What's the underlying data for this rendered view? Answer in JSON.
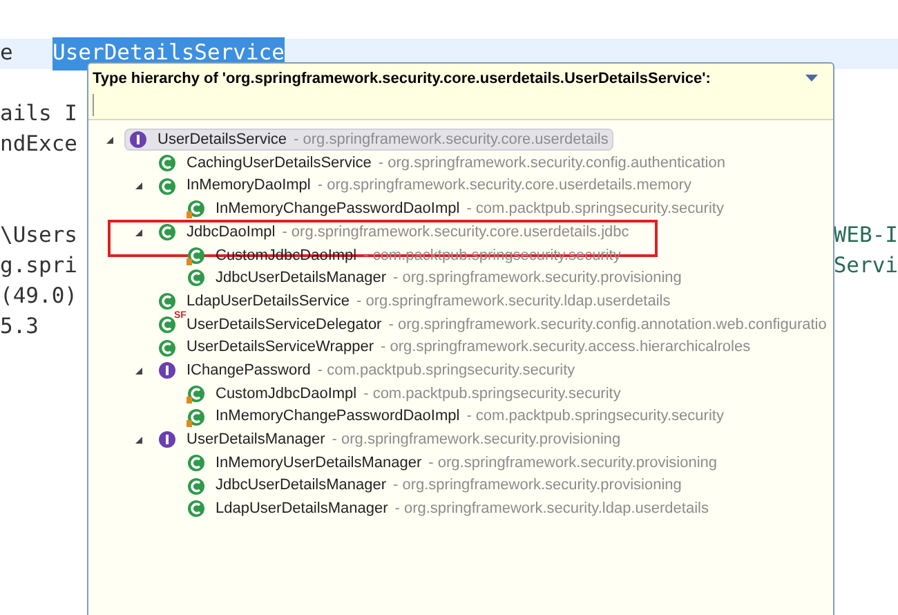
{
  "editor": {
    "lines": [
      {
        "highlight": false
      },
      {
        "text": "e",
        "selection": "UserDetailsService",
        "highlight": true
      },
      {
        "highlight": false
      },
      {
        "text": "ails I",
        "highlight": false
      },
      {
        "text": "ndExce",
        "highlight": false
      },
      {
        "highlight": false
      },
      {
        "highlight": false
      },
      {
        "text": "\\Users",
        "right": "WEB-I",
        "highlight": false
      },
      {
        "text": "g.spri",
        "right": "Servi",
        "highlight": false
      },
      {
        "text": "(49.0)",
        "highlight": false
      },
      {
        "text": "5.3",
        "highlight": false
      }
    ]
  },
  "popup": {
    "title": "Type hierarchy of 'org.springframework.security.core.userdetails.UserDetailsService':",
    "tree": [
      {
        "name": "UserDetailsService",
        "package": "- org.springframework.security.core.userdetails",
        "kind": "interface",
        "selected": true,
        "expanded": true,
        "children": [
          {
            "name": "CachingUserDetailsService",
            "package": "- org.springframework.security.config.authentication",
            "kind": "class",
            "selected": false
          },
          {
            "name": "InMemoryDaoImpl",
            "package": "- org.springframework.security.core.userdetails.memory",
            "kind": "class",
            "selected": false,
            "expanded": true,
            "children": [
              {
                "name": "InMemoryChangePasswordDaoImpl",
                "package": "- com.packtpub.springsecurity.security",
                "kind": "class-marked",
                "selected": false
              }
            ]
          },
          {
            "name": "JdbcDaoImpl",
            "package": "- org.springframework.security.core.userdetails.jdbc",
            "kind": "class",
            "selected": false,
            "circled": true,
            "expanded": true,
            "children": [
              {
                "name": "CustomJdbcDaoImpl",
                "package": "- com.packtpub.springsecurity.security",
                "kind": "class-marked",
                "selected": false
              },
              {
                "name": "JdbcUserDetailsManager",
                "package": "- org.springframework.security.provisioning",
                "kind": "class",
                "selected": false
              }
            ]
          },
          {
            "name": "LdapUserDetailsService",
            "package": "- org.springframework.security.ldap.userdetails",
            "kind": "class",
            "selected": false
          },
          {
            "name": "UserDetailsServiceDelegator",
            "package": "- org.springframework.security.config.annotation.web.configuratio",
            "kind": "class",
            "badge": "SF",
            "selected": false
          },
          {
            "name": "UserDetailsServiceWrapper",
            "package": "- org.springframework.security.access.hierarchicalroles",
            "kind": "class",
            "selected": false
          },
          {
            "name": "IChangePassword",
            "package": "- com.packtpub.springsecurity.security",
            "kind": "interface",
            "selected": false,
            "expanded": true,
            "children": [
              {
                "name": "CustomJdbcDaoImpl",
                "package": "- com.packtpub.springsecurity.security",
                "kind": "class-marked",
                "selected": false
              },
              {
                "name": "InMemoryChangePasswordDaoImpl",
                "package": "- com.packtpub.springsecurity.security",
                "kind": "class-marked",
                "selected": false
              }
            ]
          },
          {
            "name": "UserDetailsManager",
            "package": "- org.springframework.security.provisioning",
            "kind": "interface",
            "selected": false,
            "expanded": true,
            "children": [
              {
                "name": "InMemoryUserDetailsManager",
                "package": "- org.springframework.security.provisioning",
                "kind": "class",
                "selected": false
              },
              {
                "name": "JdbcUserDetailsManager",
                "package": "- org.springframework.security.provisioning",
                "kind": "class",
                "selected": false
              },
              {
                "name": "LdapUserDetailsManager",
                "package": "- org.springframework.security.ldap.userdetails",
                "kind": "class",
                "selected": false
              }
            ]
          }
        ]
      }
    ]
  }
}
